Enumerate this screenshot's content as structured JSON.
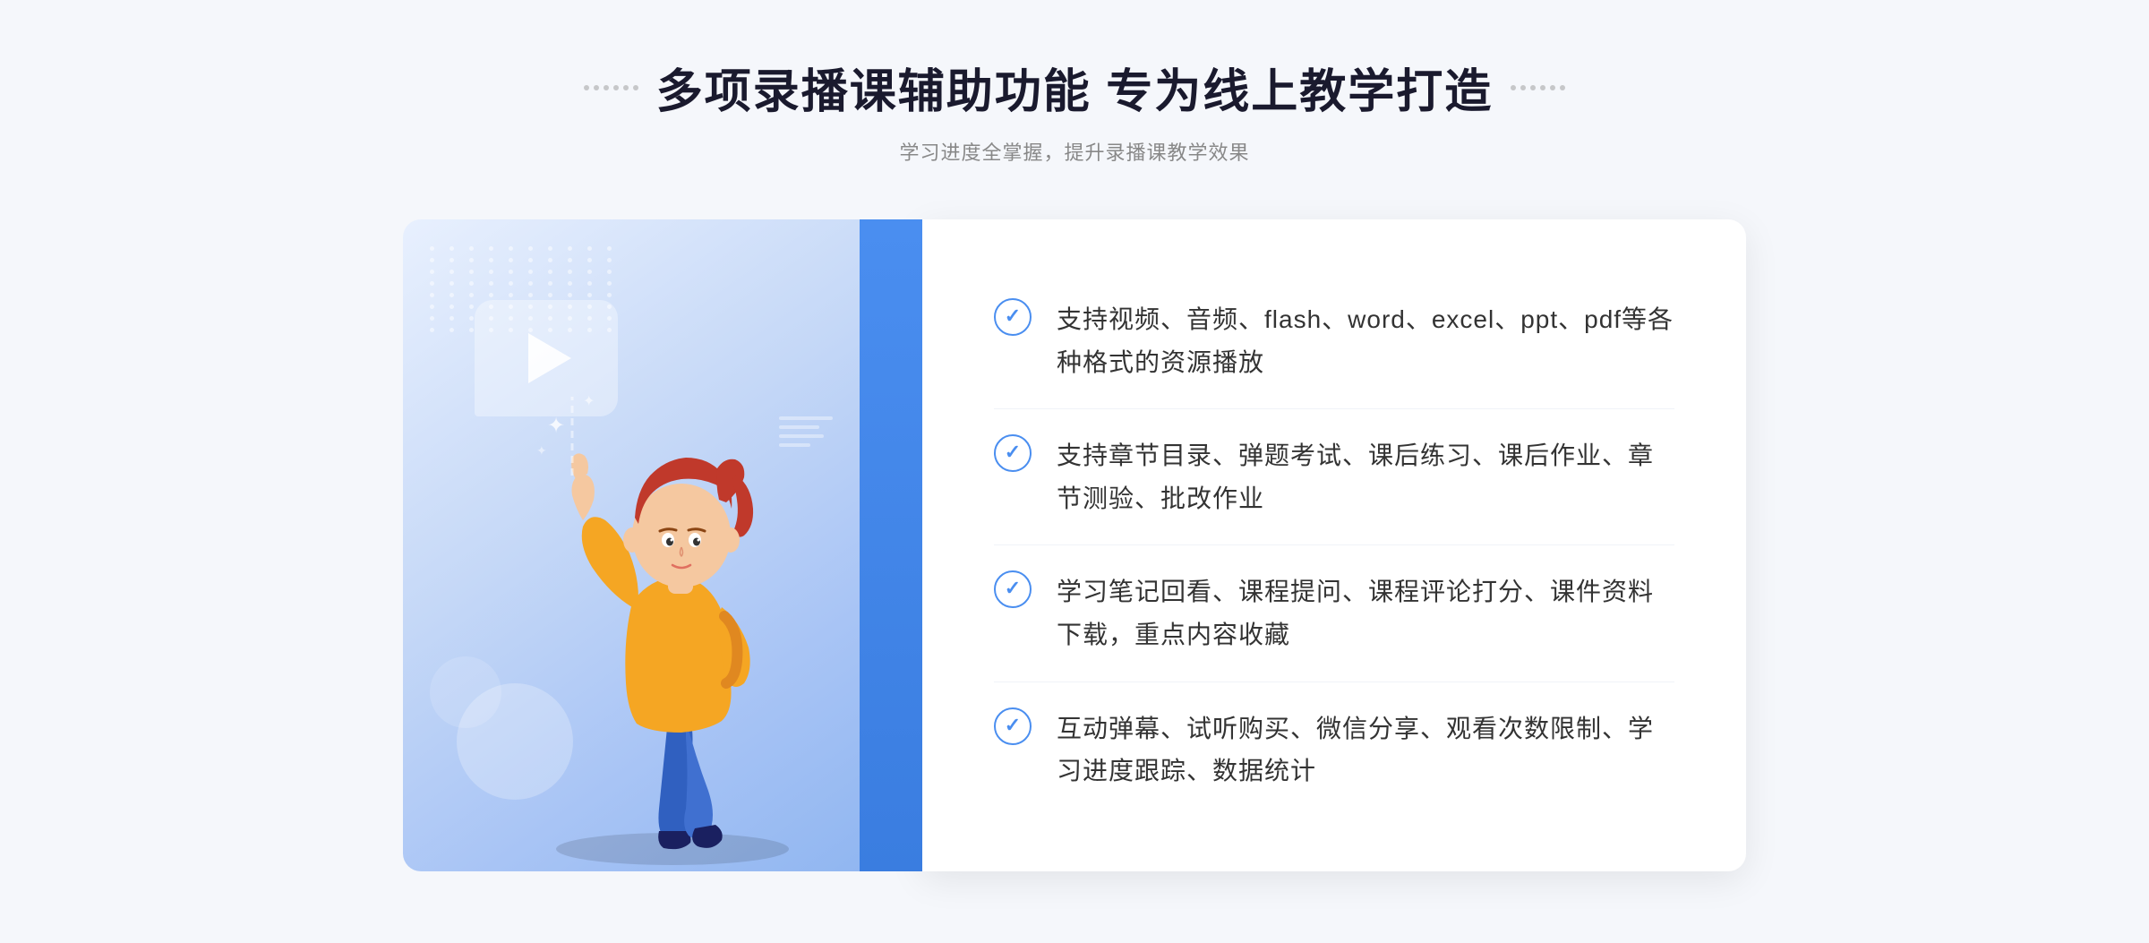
{
  "page": {
    "background_color": "#f5f7fb"
  },
  "header": {
    "title": "多项录播课辅助功能 专为线上教学打造",
    "subtitle": "学习进度全掌握，提升录播课教学效果",
    "title_dots_label": "decorative dots"
  },
  "features": [
    {
      "id": 1,
      "text": "支持视频、音频、flash、word、excel、ppt、pdf等各种格式的资源播放"
    },
    {
      "id": 2,
      "text": "支持章节目录、弹题考试、课后练习、课后作业、章节测验、批改作业"
    },
    {
      "id": 3,
      "text": "学习笔记回看、课程提问、课程评论打分、课件资料下载，重点内容收藏"
    },
    {
      "id": 4,
      "text": "互动弹幕、试听购买、微信分享、观看次数限制、学习进度跟踪、数据统计"
    }
  ],
  "illustration": {
    "play_bubble_label": "video play bubble",
    "character_label": "teaching character illustration"
  },
  "decorations": {
    "chevrons": "»",
    "accent_color": "#4a8ef0"
  }
}
